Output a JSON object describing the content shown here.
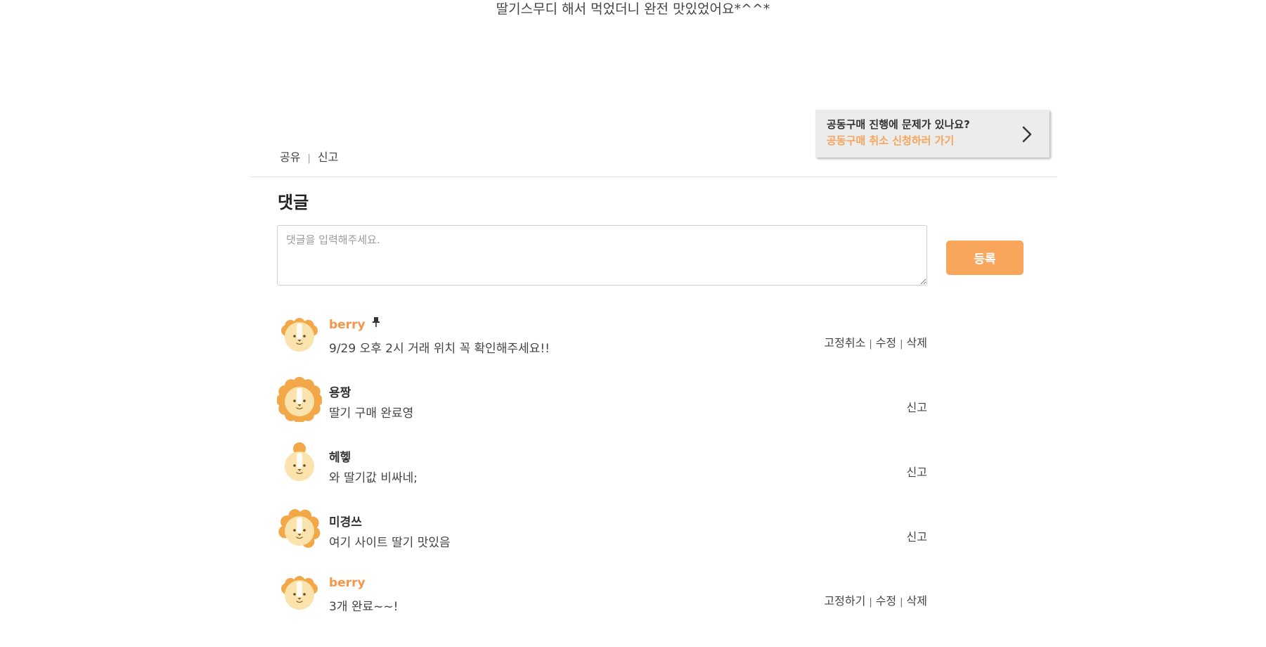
{
  "post": {
    "body_text": "딸기스무디 해서 먹었더니 완전 맛있었어요*^^*"
  },
  "cancel_banner": {
    "question": "공동구매 진행에 문제가 있나요?",
    "link_text": "공동구매 취소 신청하러 가기",
    "icon": "chevron-right-icon"
  },
  "post_actions": {
    "share_label": "공유",
    "report_label": "신고"
  },
  "comments_section": {
    "title": "댓글",
    "input_placeholder": "댓글을 입력해주세요.",
    "input_value": "",
    "submit_label": "등록"
  },
  "comments": [
    {
      "author": "berry",
      "is_owner": true,
      "pinned": true,
      "text": "9/29 오후 2시 거래 위치 꼭 확인해주세요!!",
      "actions": [
        "고정취소",
        "수정",
        "삭제"
      ]
    },
    {
      "author": "용짱",
      "is_owner": false,
      "pinned": false,
      "text": "딸기 구매 완료영",
      "actions": [
        "신고"
      ]
    },
    {
      "author": "헤헿",
      "is_owner": false,
      "pinned": false,
      "text": "와 딸기값 비싸네;",
      "actions": [
        "신고"
      ]
    },
    {
      "author": "미경쓰",
      "is_owner": false,
      "pinned": false,
      "text": "여기 사이트 딸기 맛있음",
      "actions": [
        "신고"
      ]
    },
    {
      "author": "berry",
      "is_owner": true,
      "pinned": false,
      "text": "3개 완료~~!",
      "actions": [
        "고정하기",
        "수정",
        "삭제"
      ]
    }
  ],
  "colors": {
    "accent": "#f8a65c",
    "owner_name": "#f4964a",
    "banner_bg": "#ececec",
    "lion_mane": "#f2a849",
    "lion_face": "#fbe3ad"
  }
}
